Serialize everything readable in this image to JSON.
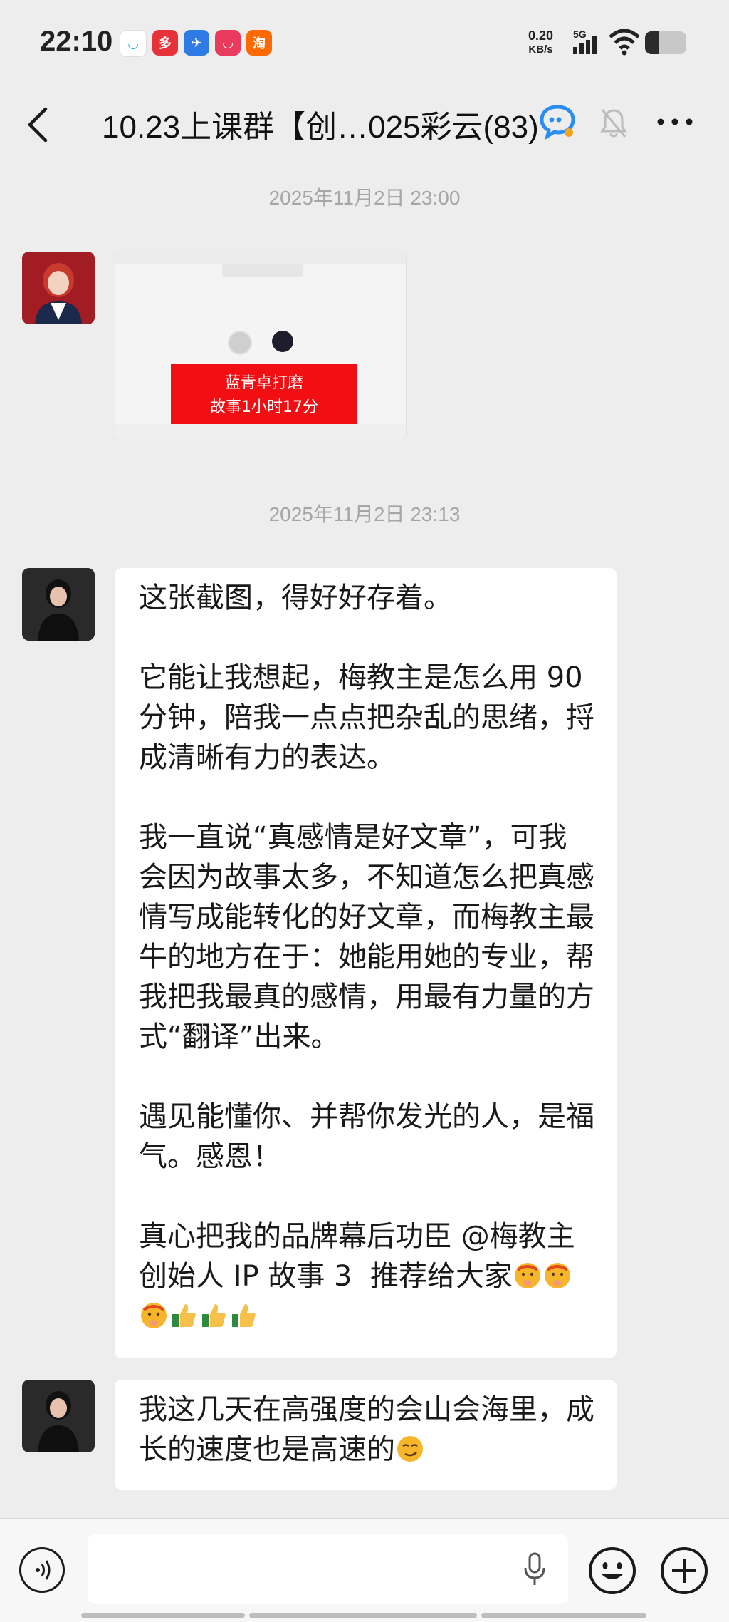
{
  "status_bar": {
    "time": "22:10",
    "net_speed_value": "0.20",
    "net_speed_unit": "KB/s",
    "network_type": "5G",
    "battery_level_percent": 35,
    "app_icons": [
      {
        "name": "chat-bubble-icon",
        "color": "#ffffff",
        "glyph": "◡"
      },
      {
        "name": "shopping-app-icon",
        "color": "#e8323a",
        "glyph": "多"
      },
      {
        "name": "train-app-icon",
        "color": "#2f7be6",
        "glyph": "✈"
      },
      {
        "name": "red-app-icon",
        "color": "#e83b5d",
        "glyph": "◡"
      },
      {
        "name": "taobao-icon",
        "color": "#ff6a00",
        "glyph": "淘"
      }
    ]
  },
  "header": {
    "title": "10.23上课群【创…025彩云(83)"
  },
  "messages": {
    "timestamp_1": "2025年11月2日 23:00",
    "timestamp_2": "2025年11月2日 23:13",
    "image_message": {
      "banner_line_1": "蓝青卓打磨",
      "banner_line_2": "故事1小时17分"
    },
    "text_message_1": {
      "paragraphs": [
        "这张截图，得好好存着。",
        "它能让我想起，梅教主是怎么用 90 分钟，陪我一点点把杂乱的思绪，捋成清晰有力的表达。",
        "我一直说“真感情是好文章”，可我会因为故事太多，不知道怎么把真感情写成能转化的好文章，而梅教主最牛的地方在于：她能用她的专业，帮我把我最真的感情，用最有力量的方式“翻译”出来。",
        "遇见能懂你、并帮你发光的人，是福气。感恩！"
      ],
      "last_paragraph": "真心把我的品牌幕后功臣 @梅教主创始人 IP 故事 3  推荐给大家"
    },
    "text_message_2": {
      "text": "我这几天在高强度的会山会海里，成长的速度也是高速的"
    }
  },
  "input": {
    "value": "",
    "placeholder": ""
  },
  "colors": {
    "background": "#ededed",
    "bubble": "#ffffff",
    "timestamp": "#a6a6a6",
    "banner_red": "#f20f14"
  }
}
